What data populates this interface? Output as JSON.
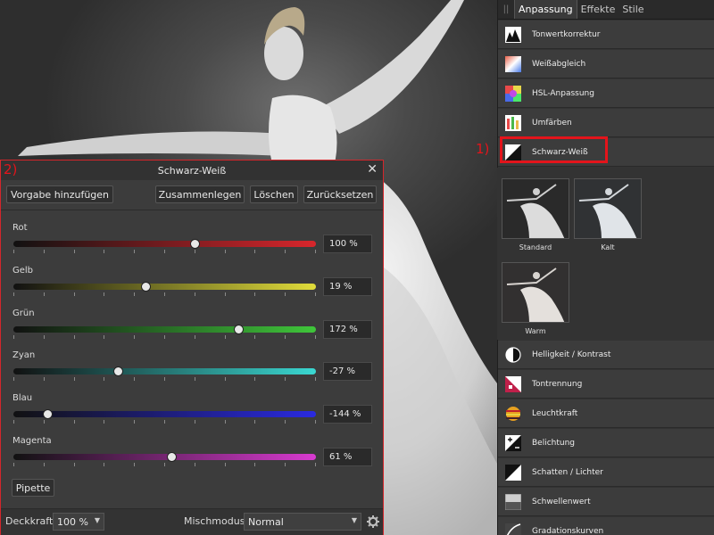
{
  "panel": {
    "tabs": [
      "Anpassung",
      "Effekte",
      "Stile"
    ],
    "grip": "||",
    "adjustments_top": [
      {
        "label": "Tonwertkorrektur",
        "icon": "levels-icon"
      },
      {
        "label": "Weißabgleich",
        "icon": "white-balance-icon"
      },
      {
        "label": "HSL-Anpassung",
        "icon": "hsl-icon"
      },
      {
        "label": "Umfärben",
        "icon": "recolor-icon"
      },
      {
        "label": "Schwarz-Weiß",
        "icon": "black-white-icon"
      }
    ],
    "presets": [
      "Standard",
      "Kalt",
      "Warm"
    ],
    "adjustments_bottom": [
      {
        "label": "Helligkeit / Kontrast",
        "icon": "brightness-contrast-icon"
      },
      {
        "label": "Tontrennung",
        "icon": "posterize-icon"
      },
      {
        "label": "Leuchtkraft",
        "icon": "vibrance-icon"
      },
      {
        "label": "Belichtung",
        "icon": "exposure-icon"
      },
      {
        "label": "Schatten / Lichter",
        "icon": "shadows-highlights-icon"
      },
      {
        "label": "Schwellenwert",
        "icon": "threshold-icon"
      },
      {
        "label": "Gradationskurven",
        "icon": "curves-icon"
      }
    ]
  },
  "annotations": {
    "one": "1)",
    "two": "2)"
  },
  "dialog": {
    "title": "Schwarz-Weiß",
    "close": "✕",
    "buttons": {
      "add_preset": "Vorgabe hinzufügen",
      "merge": "Zusammenlegen",
      "delete": "Löschen",
      "reset": "Zurücksetzen"
    },
    "channels": [
      {
        "name": "Rot",
        "value": 100,
        "display": "100 %",
        "min": -200,
        "max": 300,
        "color": "#d8262c"
      },
      {
        "name": "Gelb",
        "value": 19,
        "display": "19 %",
        "min": -200,
        "max": 300,
        "color": "#e0dc3a"
      },
      {
        "name": "Grün",
        "value": 172,
        "display": "172 %",
        "min": -200,
        "max": 300,
        "color": "#3fc63a"
      },
      {
        "name": "Zyan",
        "value": -27,
        "display": "-27 %",
        "min": -200,
        "max": 300,
        "color": "#3ad8d2"
      },
      {
        "name": "Blau",
        "value": -144,
        "display": "-144 %",
        "min": -200,
        "max": 300,
        "color": "#2a2ae0"
      },
      {
        "name": "Magenta",
        "value": 61,
        "display": "61 %",
        "min": -200,
        "max": 300,
        "color": "#d83ad0"
      }
    ],
    "pipette": "Pipette",
    "footer": {
      "opacity_label": "Deckkraft:",
      "opacity_value": "100 %",
      "blend_label": "Mischmodus:",
      "blend_value": "Normal"
    }
  },
  "colors": {
    "accent_red": "#e3141b"
  }
}
